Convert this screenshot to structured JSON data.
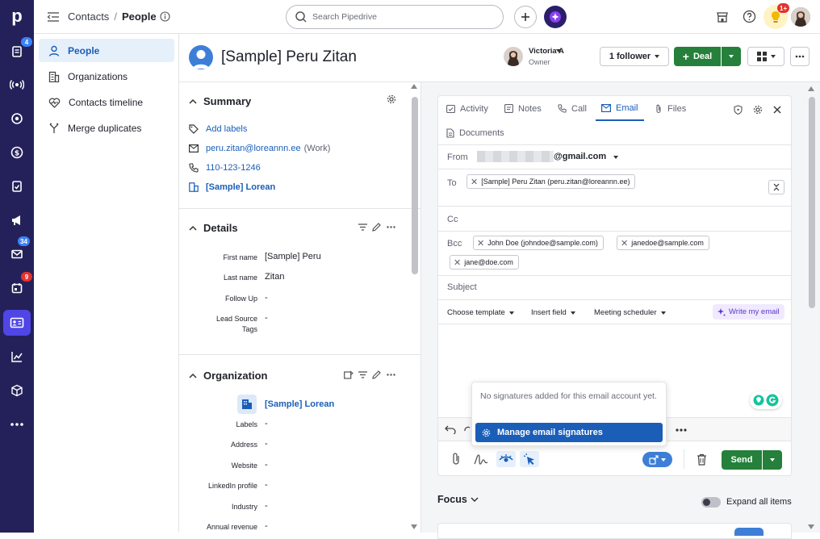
{
  "rail": {
    "logo": "p",
    "badges": {
      "deals": "4",
      "mail": "34",
      "activities": "9"
    }
  },
  "topbar": {
    "breadcrumb_parent": "Contacts",
    "breadcrumb_sep": "/",
    "breadcrumb_current": "People",
    "search_placeholder": "Search Pipedrive",
    "notif_badge": "1+"
  },
  "nav": {
    "items": [
      {
        "label": "People"
      },
      {
        "label": "Organizations"
      },
      {
        "label": "Contacts timeline"
      },
      {
        "label": "Merge duplicates"
      }
    ]
  },
  "header": {
    "title": "[Sample] Peru Zitan",
    "owner_name": "Victoria A",
    "owner_role": "Owner",
    "follower_label": "1 follower",
    "deal_label": "Deal"
  },
  "summary": {
    "title": "Summary",
    "add_labels": "Add labels",
    "email": "peru.zitan@loreannn.ee",
    "email_type": "(Work)",
    "phone": "110-123-1246",
    "org": "[Sample] Lorean"
  },
  "details": {
    "title": "Details",
    "fields": [
      {
        "label": "First name",
        "value": "[Sample] Peru"
      },
      {
        "label": "Last name",
        "value": "Zitan"
      },
      {
        "label": "Follow Up",
        "value": "-"
      },
      {
        "label": "Lead Source",
        "label2": "Tags",
        "value": "-"
      }
    ]
  },
  "organization": {
    "title": "Organization",
    "name": "[Sample] Lorean",
    "fields": [
      {
        "label": "Labels",
        "value": "-"
      },
      {
        "label": "Address",
        "value": "-"
      },
      {
        "label": "Website",
        "value": "-"
      },
      {
        "label": "LinkedIn profile",
        "value": "-"
      },
      {
        "label": "Industry",
        "value": "-"
      },
      {
        "label": "Annual revenue",
        "value": "-"
      }
    ]
  },
  "composer": {
    "tabs": [
      "Activity",
      "Notes",
      "Call",
      "Email",
      "Files",
      "Documents"
    ],
    "from_label": "From",
    "from_value": "@gmail.com",
    "to_label": "To",
    "to_chip": "[Sample] Peru Zitan (peru.zitan@loreannn.ee)",
    "cc_label": "Cc",
    "bcc_label": "Bcc",
    "bcc_chips": [
      "John Doe (johndoe@sample.com)",
      "janedoe@sample.com",
      "jane@doe.com"
    ],
    "subject_placeholder": "Subject",
    "choose_template": "Choose template",
    "insert_field": "Insert field",
    "meeting_scheduler": "Meeting scheduler",
    "write_my_email": "Write my email",
    "send_label": "Send"
  },
  "popup": {
    "message": "No signatures added for this email account yet.",
    "manage_label": "Manage email signatures"
  },
  "focus": {
    "title": "Focus",
    "expand_label": "Expand all items"
  },
  "colors": {
    "rail_bg": "#24215a",
    "accent_blue": "#1a5eb8",
    "deal_green": "#24803a",
    "active_nav_bg": "#e6f0fb"
  }
}
